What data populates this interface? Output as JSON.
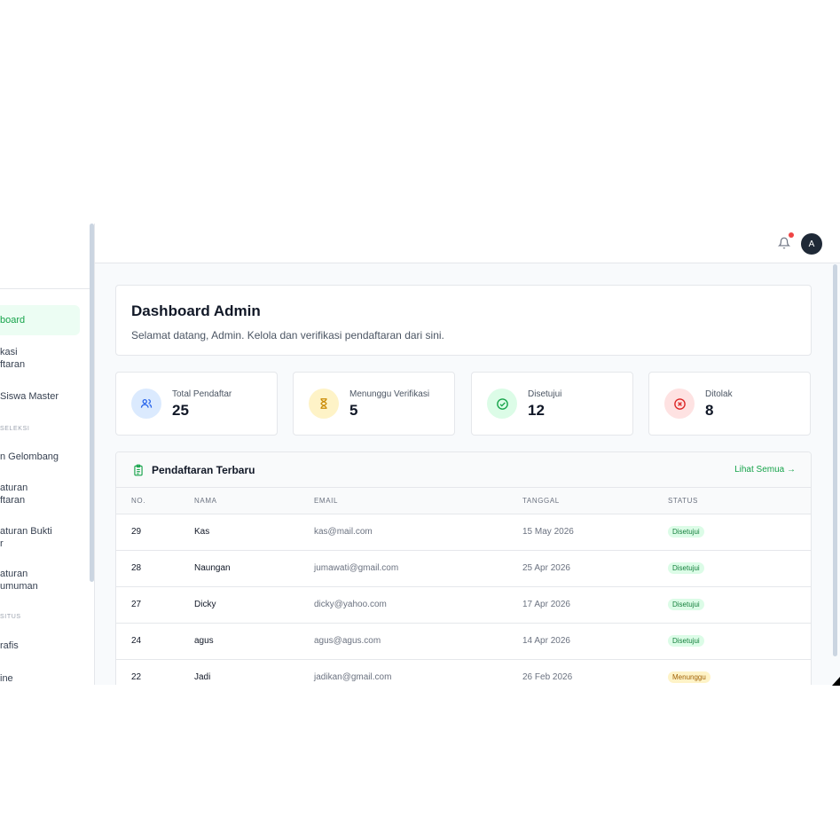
{
  "sidebar": {
    "items": [
      {
        "label": "board",
        "active": true
      },
      {
        "label": "kasi\nftaran"
      },
      {
        "label": "Siswa Master"
      },
      {
        "label": "n Gelombang"
      },
      {
        "label": "aturan\nftaran"
      },
      {
        "label": "aturan Bukti\nr"
      },
      {
        "label": "aturan\numuman"
      },
      {
        "label": "rafis"
      },
      {
        "label": "ine"
      }
    ],
    "sections": [
      "SELEKSI",
      "SITUS"
    ]
  },
  "topbar": {
    "avatar_initial": "A",
    "notification_icon": "bell-icon"
  },
  "welcome": {
    "title": "Dashboard Admin",
    "subtitle": "Selamat datang, Admin. Kelola dan verifikasi pendaftaran dari sini."
  },
  "stats": [
    {
      "label": "Total Pendaftar",
      "value": "25",
      "icon": "users-icon",
      "bg": "#dbeafe",
      "fg": "#2563eb"
    },
    {
      "label": "Menunggu Verifikasi",
      "value": "5",
      "icon": "hourglass-icon",
      "bg": "#fef3c7",
      "fg": "#ca8a04"
    },
    {
      "label": "Disetujui",
      "value": "12",
      "icon": "check-circle-icon",
      "bg": "#dcfce7",
      "fg": "#16a34a"
    },
    {
      "label": "Ditolak",
      "value": "8",
      "icon": "x-circle-icon",
      "bg": "#fee2e2",
      "fg": "#dc2626"
    }
  ],
  "recent": {
    "title": "Pendaftaran Terbaru",
    "see_all": "Lihat Semua →",
    "columns": [
      "NO.",
      "NAMA",
      "EMAIL",
      "TANGGAL",
      "STATUS"
    ],
    "rows": [
      {
        "no": "29",
        "name": "Kas",
        "email": "kas@mail.com",
        "date": "15 May 2026",
        "status": "Disetujui",
        "kind": "ok"
      },
      {
        "no": "28",
        "name": "Naungan",
        "email": "jumawati@gmail.com",
        "date": "25 Apr 2026",
        "status": "Disetujui",
        "kind": "ok"
      },
      {
        "no": "27",
        "name": "Dicky",
        "email": "dicky@yahoo.com",
        "date": "17 Apr 2026",
        "status": "Disetujui",
        "kind": "ok"
      },
      {
        "no": "24",
        "name": "agus",
        "email": "agus@agus.com",
        "date": "14 Apr 2026",
        "status": "Disetujui",
        "kind": "ok"
      },
      {
        "no": "22",
        "name": "Jadi",
        "email": "jadikan@gmail.com",
        "date": "26 Feb 2026",
        "status": "Menunggu",
        "kind": "wait"
      }
    ]
  }
}
